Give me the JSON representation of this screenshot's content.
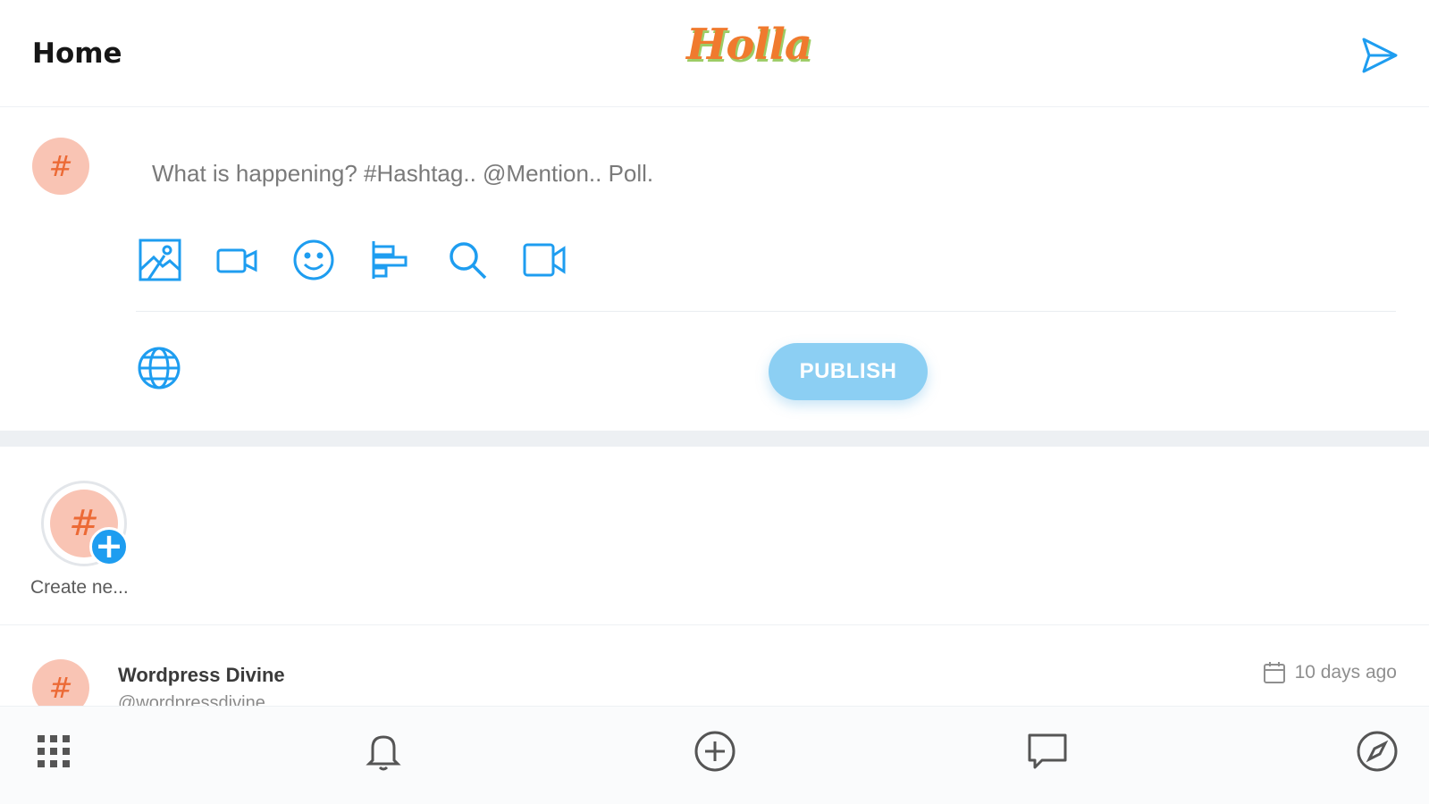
{
  "header": {
    "title": "Home",
    "logo_text": "Holla"
  },
  "composer": {
    "avatar_symbol": "#",
    "placeholder": "What is happening? #Hashtag.. @Mention.. Poll.",
    "tools": [
      "image-upload-icon",
      "video-icon",
      "emoji-icon",
      "poll-icon",
      "search-icon",
      "video-call-icon"
    ],
    "privacy_icon": "globe-icon",
    "publish_label": "PUBLISH"
  },
  "stories": {
    "create_label": "Create ne...",
    "avatar_symbol": "#",
    "plus_symbol": "+"
  },
  "post": {
    "avatar_symbol": "#",
    "name": "Wordpress Divine",
    "handle": "@wordpressdivine",
    "time": "10 days ago"
  },
  "bottom_nav": [
    "apps-grid-icon",
    "bell-icon",
    "plus-circle-icon",
    "chat-icon",
    "compass-icon"
  ],
  "colors": {
    "accent": "#1e9df0",
    "publish_bg": "#8ccff3",
    "avatar_bg": "#f9c4b4",
    "logo": "#f07a2e"
  }
}
